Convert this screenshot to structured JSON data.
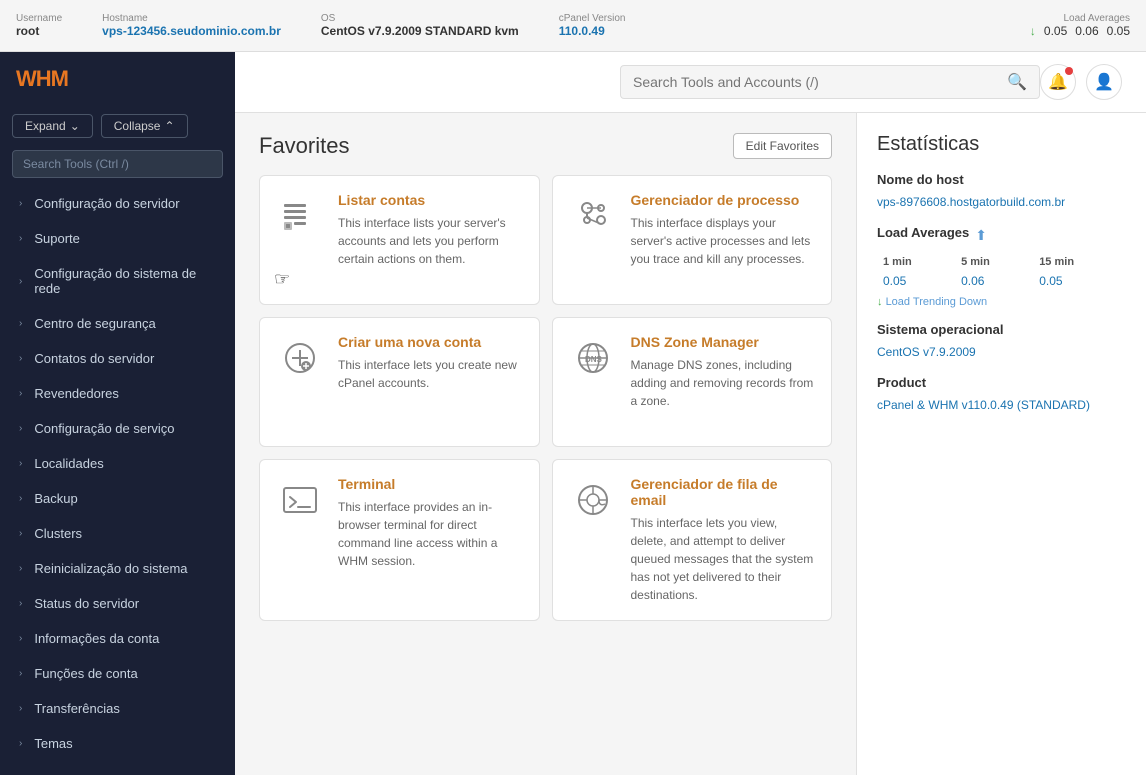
{
  "topbar": {
    "username_label": "Username",
    "username_value": "root",
    "hostname_label": "Hostname",
    "hostname_value": "vps-123456.seudominio.com.br",
    "os_label": "OS",
    "os_value": "CentOS v7.9.2009 STANDARD kvm",
    "cpanel_label": "cPanel Version",
    "cpanel_value": "110.0.49",
    "load_label": "Load Averages",
    "load_arrow": "↓",
    "load_1": "0.05",
    "load_2": "0.06",
    "load_3": "0.05"
  },
  "sidebar": {
    "logo": "WHM",
    "expand_btn": "Expand",
    "collapse_btn": "Collapse",
    "search_placeholder": "Search Tools (Ctrl /)",
    "items": [
      {
        "label": "Configuração do servidor"
      },
      {
        "label": "Suporte"
      },
      {
        "label": "Configuração do sistema de rede"
      },
      {
        "label": "Centro de segurança"
      },
      {
        "label": "Contatos do servidor"
      },
      {
        "label": "Revendedores"
      },
      {
        "label": "Configuração de serviço"
      },
      {
        "label": "Localidades"
      },
      {
        "label": "Backup"
      },
      {
        "label": "Clusters"
      },
      {
        "label": "Reinicialização do sistema"
      },
      {
        "label": "Status do servidor"
      },
      {
        "label": "Informações da conta"
      },
      {
        "label": "Funções de conta"
      },
      {
        "label": "Transferências"
      },
      {
        "label": "Temas"
      }
    ]
  },
  "header": {
    "search_placeholder": "Search Tools and Accounts (/)"
  },
  "favorites": {
    "title": "Favorites",
    "edit_btn": "Edit Favorites",
    "cards": [
      {
        "title": "Listar contas",
        "desc": "This interface lists your server's accounts and lets you perform certain actions on them."
      },
      {
        "title": "Gerenciador de processo",
        "desc": "This interface displays your server's active processes and lets you trace and kill any processes."
      },
      {
        "title": "Criar uma nova conta",
        "desc": "This interface lets you create new cPanel accounts."
      },
      {
        "title": "DNS Zone Manager",
        "desc": "Manage DNS zones, including adding and removing records from a zone."
      },
      {
        "title": "Terminal",
        "desc": "This interface provides an in-browser terminal for direct command line access within a WHM session."
      },
      {
        "title": "Gerenciador de fila de email",
        "desc": "This interface lets you view, delete, and attempt to deliver queued messages that the system has not yet delivered to their destinations."
      }
    ]
  },
  "stats": {
    "title": "Estatísticas",
    "hostname_label": "Nome do host",
    "hostname_value": "vps-8976608.hostgatorbuild.com.br",
    "load_label": "Load Averages",
    "load_1min": "1 min",
    "load_5min": "5 min",
    "load_15min": "15 min",
    "load_val1": "0.05",
    "load_val2": "0.06",
    "load_val3": "0.05",
    "load_trend": "↓ Load Trending Down",
    "os_label": "Sistema operacional",
    "os_value": "CentOS v7.9.2009",
    "product_label": "Product",
    "product_value": "cPanel & WHM v110.0.49 (STANDARD)"
  }
}
